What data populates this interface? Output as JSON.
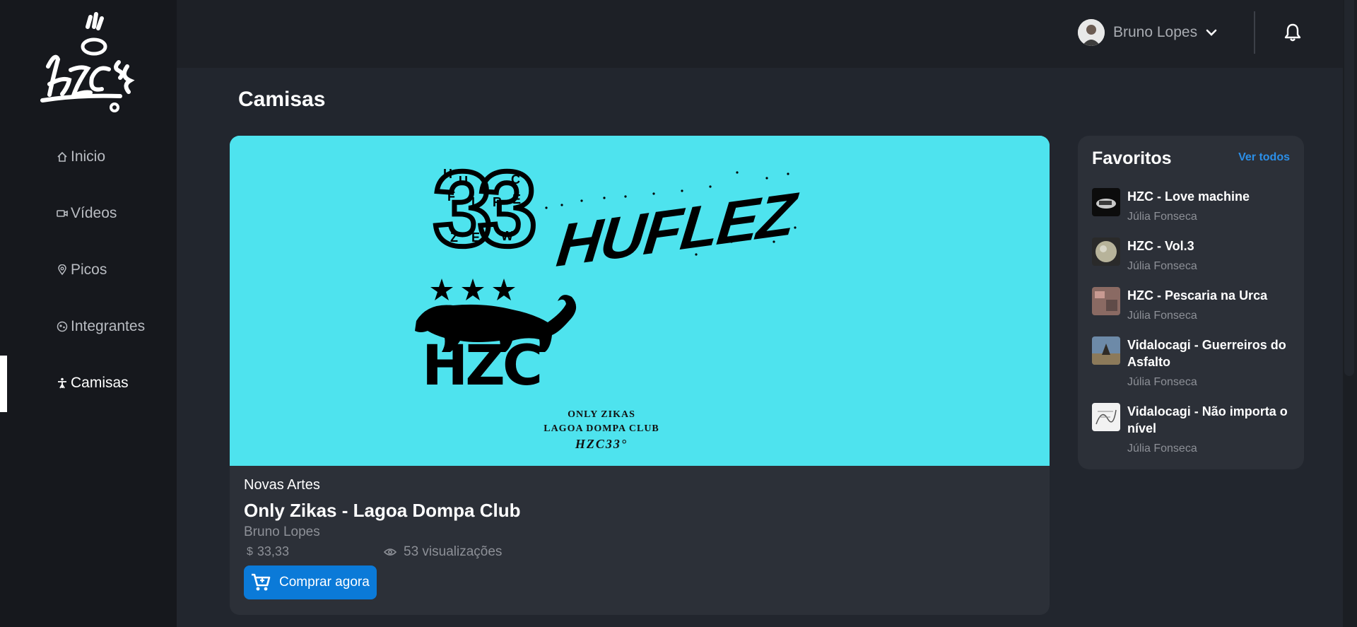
{
  "sidebar": {
    "logo_alt": "HZC",
    "items": [
      {
        "label": "Inicio",
        "icon": "home-icon"
      },
      {
        "label": "Vídeos",
        "icon": "video-icon"
      },
      {
        "label": "Picos",
        "icon": "location-pin-icon"
      },
      {
        "label": "Integrantes",
        "icon": "people-icon"
      },
      {
        "label": "Camisas",
        "icon": "shirt-person-icon",
        "active": true
      }
    ]
  },
  "header": {
    "user_name": "Bruno Lopes"
  },
  "page": {
    "title": "Camisas"
  },
  "product": {
    "category": "Novas Artes",
    "title": "Only Zikas - Lagoa Dompa Club",
    "author": "Bruno Lopes",
    "price": "33,33",
    "currency_symbol": "$",
    "views": "53 visualizações",
    "buy_label": "Comprar agora",
    "image_text": {
      "badge_letters": "HUCFLREZEW",
      "badge_number": "33",
      "brand": "HUFLEZ",
      "logo": "HZC",
      "line1": "ONLY ZIKAS",
      "line2": "LAGOA DOMPA CLUB",
      "line3": "HZC33°"
    },
    "image_background": "#4ee3ee"
  },
  "favorites": {
    "title": "Favoritos",
    "see_all": "Ver todos",
    "items": [
      {
        "name": "HZC - Love machine",
        "artist": "Júlia Fonseca"
      },
      {
        "name": "HZC - Vol.3",
        "artist": "Júlia Fonseca"
      },
      {
        "name": "HZC - Pescaria na Urca",
        "artist": "Júlia Fonseca"
      },
      {
        "name": "Vidalocagi - Guerreiros do Asfalto",
        "artist": "Júlia Fonseca"
      },
      {
        "name": "Vidalocagi - Não importa o nível",
        "artist": "Júlia Fonseca"
      }
    ]
  },
  "colors": {
    "accent": "#0b7ad8",
    "link": "#2b8fe8",
    "sidebar_bg": "#16181d",
    "page_bg": "#22262e",
    "card_bg": "#2c3038"
  }
}
